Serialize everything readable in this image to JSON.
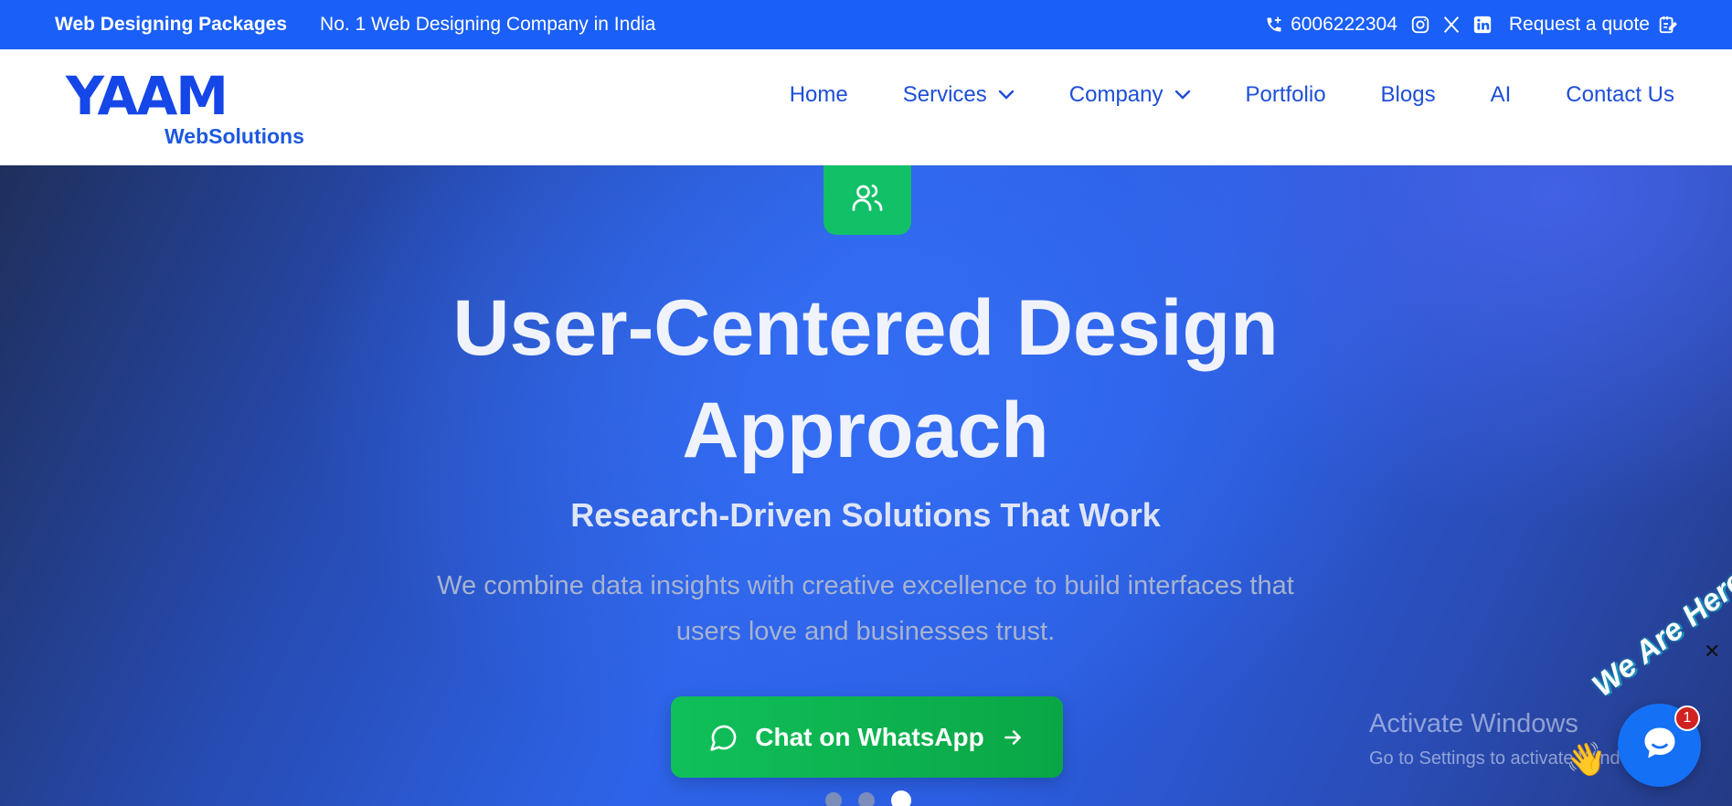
{
  "topbar": {
    "packages_link": "Web Designing Packages",
    "tagline": "No. 1 Web Designing Company in India",
    "phone": "6006222304",
    "social_icons": [
      "instagram-icon",
      "x-icon",
      "linkedin-icon"
    ],
    "quote_link": "Request a quote"
  },
  "logo": {
    "mark": "YAAM",
    "sub": "WebSolutions"
  },
  "nav": {
    "items": [
      {
        "label": "Home"
      },
      {
        "label": "Services"
      },
      {
        "label": "Company"
      },
      {
        "label": "Portfolio"
      },
      {
        "label": "Blogs"
      },
      {
        "label": "AI"
      },
      {
        "label": "Contact Us"
      }
    ]
  },
  "hero": {
    "badge_icon": "users-icon",
    "title_line1": "User-Centered Design",
    "title_line2": "Approach",
    "subtitle": "Research-Driven Solutions That Work",
    "description": "We combine data insights with creative excellence to build interfaces that users love and businesses trust.",
    "cta_label": "Chat on WhatsApp",
    "slides_total": 3,
    "slide_active": 3
  },
  "watermark": {
    "line1": "Activate Windows",
    "line2": "Go to Settings to activate Windows."
  },
  "chat": {
    "tag": "We Are Here!",
    "badge_count": "1",
    "close": "✕",
    "wave": "👋"
  },
  "colors": {
    "topbar": "#1a5ff8",
    "nav_text": "#1d4ed8",
    "badge_green": "#12c067",
    "cta_green": "#10c05a",
    "chat_blue": "#1470f5"
  }
}
